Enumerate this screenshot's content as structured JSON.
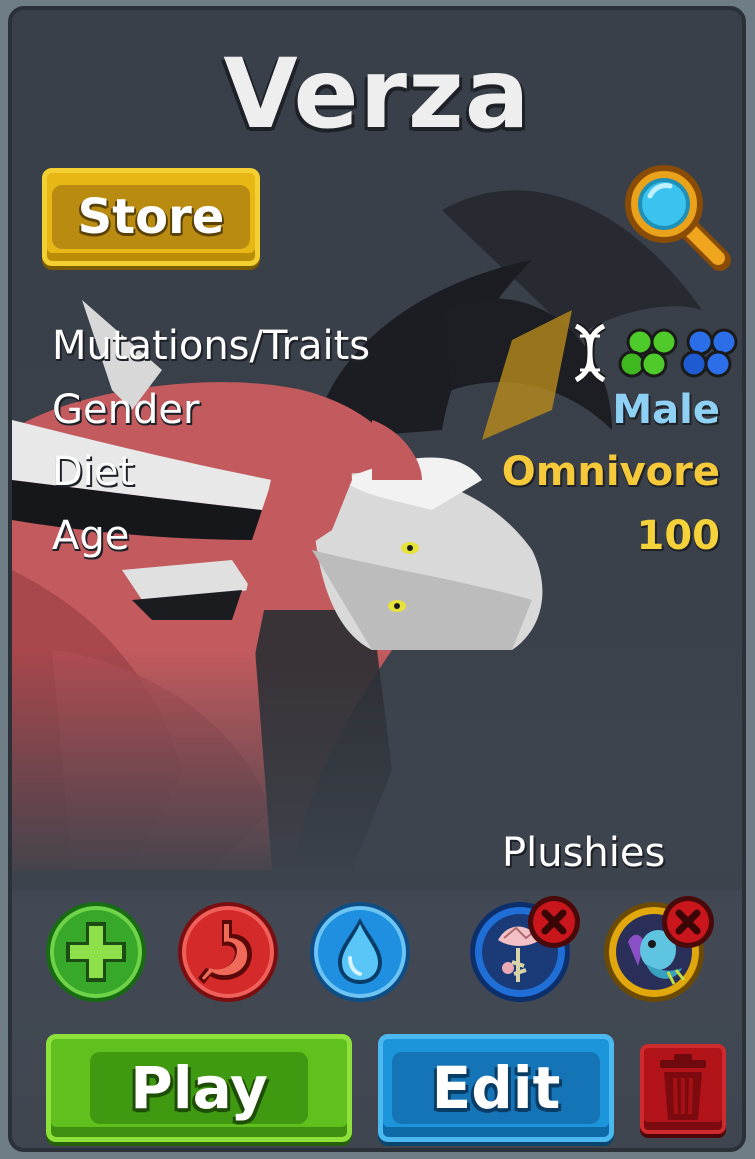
{
  "creature": {
    "name": "Verza"
  },
  "buttons": {
    "store": "Store",
    "play": "Play",
    "edit": "Edit"
  },
  "stats": [
    {
      "label": "Mutations/Traits",
      "value": ""
    },
    {
      "label": "Gender",
      "value": "Male",
      "color": "#8fd1f5"
    },
    {
      "label": "Diet",
      "value": "Omnivore",
      "color": "#f5c93a"
    },
    {
      "label": "Age",
      "value": "100",
      "color": "#f5d23a"
    }
  ],
  "trait_icons": [
    "dna-icon",
    "green-cells-icon",
    "blue-cells-icon"
  ],
  "plushies": {
    "label": "Plushies",
    "items": [
      {
        "icon": "pink-flower-plushie-icon",
        "ring_color": "#1f6fd6"
      },
      {
        "icon": "blue-creature-plushie-icon",
        "ring_color": "#e0a80c"
      }
    ]
  },
  "care_buttons": [
    {
      "icon": "plus-icon",
      "color": "#38a82a"
    },
    {
      "icon": "stomach-icon",
      "color": "#d42a2a"
    },
    {
      "icon": "water-drop-icon",
      "color": "#1f8fe0"
    }
  ],
  "colors": {
    "panel_bg": "#3b414a",
    "store": "#e7b716",
    "play": "#5fc01e",
    "edit": "#1c95db",
    "delete": "#b3141a"
  }
}
